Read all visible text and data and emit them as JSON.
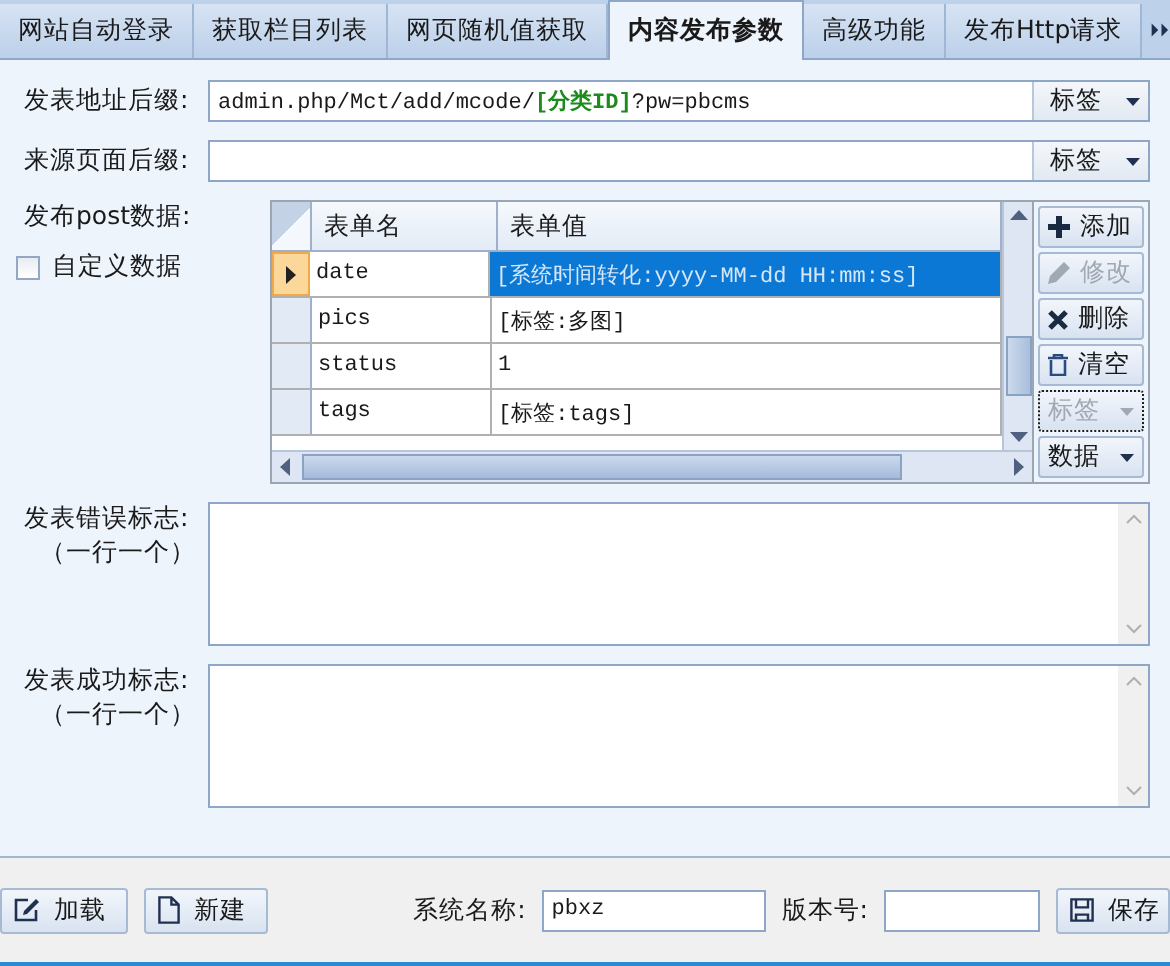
{
  "tabs": [
    {
      "label": "网站自动登录",
      "selected": false
    },
    {
      "label": "获取栏目列表",
      "selected": false
    },
    {
      "label": "网页随机值获取",
      "selected": false
    },
    {
      "label": "内容发布参数",
      "selected": true
    },
    {
      "label": "高级功能",
      "selected": false
    },
    {
      "label": "发布Http请求",
      "selected": false
    }
  ],
  "fields": [
    {
      "label": "发表地址后缀:",
      "value": "admin.php/Mct/add/mcode/**[分类ID]**?pw=pbcms",
      "button": "标签"
    },
    {
      "label": "来源页面后缀:",
      "button": "标签"
    }
  ],
  "post_data": {
    "label": "发布post数据:",
    "custom": {
      "label": "自定义数据",
      "checked": false
    },
    "columns": [
      "表单名",
      "表单值"
    ],
    "rows": [
      {
        "name": "date",
        "value": "[系统时间转化:yyyy-MM-dd HH:mm:ss]",
        "selected": true
      },
      {
        "name": "pics",
        "value": "[标签:多图]",
        "selected": false
      },
      {
        "name": "status",
        "value": "1",
        "selected": false
      },
      {
        "name": "tags",
        "value": "[标签:tags]",
        "selected": false
      }
    ],
    "actions": [
      {
        "label": "添加",
        "kind": "add",
        "disabled": false
      },
      {
        "label": "修改",
        "kind": "edit",
        "disabled": true
      },
      {
        "label": "删除",
        "kind": "delete",
        "disabled": false
      },
      {
        "label": "清空",
        "kind": "clear",
        "disabled": false
      },
      {
        "label": "标签",
        "kind": "dropdown",
        "disabled": true
      },
      {
        "label": "数据",
        "kind": "dropdown",
        "disabled": false
      }
    ]
  },
  "areas": [
    {
      "label": "发表错误标志:",
      "note": "（一行一个）"
    },
    {
      "label": "发表成功标志:",
      "note": "（一行一个）"
    }
  ],
  "footer": {
    "buttons": [
      {
        "label": "加载",
        "kind": "edit"
      },
      {
        "label": "新建",
        "kind": "new"
      }
    ],
    "system_name": {
      "label": "系统名称:",
      "value": "pbxz"
    },
    "version": {
      "label": "版本号:"
    },
    "save": "保存"
  }
}
